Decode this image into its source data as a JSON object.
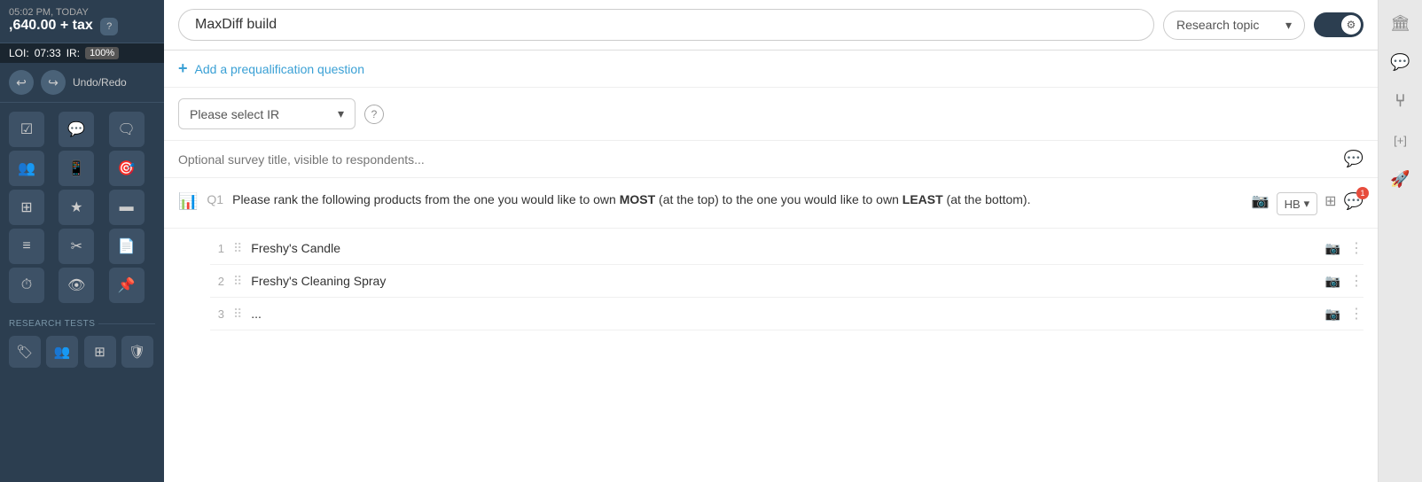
{
  "sidebar": {
    "timestamp": "05:02 PM, TODAY",
    "price": ",640.00 + tax",
    "help_icon": "?",
    "loi_label": "LOI:",
    "loi_value": "07:33",
    "ir_label": "IR:",
    "ir_value": "100%",
    "undo_redo_label": "Undo/Redo",
    "research_tests_label": "RESEARCH TESTS",
    "icons": [
      {
        "name": "checkbox-icon",
        "symbol": "☑"
      },
      {
        "name": "chat-bubble-icon",
        "symbol": "💬"
      },
      {
        "name": "speech-icon",
        "symbol": "🗨"
      },
      {
        "name": "audience-icon",
        "symbol": "👥"
      },
      {
        "name": "mobile-icon",
        "symbol": "📱"
      },
      {
        "name": "target-icon",
        "symbol": "🎯"
      },
      {
        "name": "table-icon",
        "symbol": "⊞"
      },
      {
        "name": "star-icon",
        "symbol": "★"
      },
      {
        "name": "slider-icon",
        "symbol": "▬"
      },
      {
        "name": "list-icon",
        "symbol": "≡"
      },
      {
        "name": "scissors-icon",
        "symbol": "✂"
      },
      {
        "name": "document-icon",
        "symbol": "📄"
      },
      {
        "name": "timer-icon",
        "symbol": "⏱"
      },
      {
        "name": "eye-off-icon",
        "symbol": "👁"
      },
      {
        "name": "pin-icon",
        "symbol": "📌"
      }
    ],
    "research_icons": [
      {
        "name": "tag-icon",
        "symbol": "🏷"
      },
      {
        "name": "users-icon",
        "symbol": "👥"
      },
      {
        "name": "grid-icon",
        "symbol": "⊞"
      },
      {
        "name": "shield-icon",
        "symbol": "🛡"
      }
    ]
  },
  "topbar": {
    "survey_title": "MaxDiff build",
    "survey_title_placeholder": "MaxDiff build",
    "research_topic_label": "Research topic",
    "gear_icon": "⚙"
  },
  "prequal": {
    "add_icon": "+",
    "add_text": "Add a prequalification question"
  },
  "ir_select": {
    "placeholder": "Please select IR",
    "help_icon": "?"
  },
  "optional_title": {
    "placeholder": "Optional survey title, visible to respondents..."
  },
  "question": {
    "number": "Q1",
    "text_part1": "Please rank the following products from the one you would like to own ",
    "text_bold1": "MOST",
    "text_part2": " (at the top) to the one you would like to own ",
    "text_bold2": "LEAST",
    "text_part3": " (at the bottom).",
    "hb_label": "HB",
    "comment_badge": "1"
  },
  "items": [
    {
      "number": "1",
      "text": "Freshy's Candle"
    },
    {
      "number": "2",
      "text": "Freshy's Cleaning Spray"
    },
    {
      "number": "3",
      "text": "..."
    }
  ],
  "right_panel": {
    "icons": [
      {
        "name": "building-icon",
        "symbol": "🏛"
      },
      {
        "name": "comment-panel-icon",
        "symbol": "💬"
      },
      {
        "name": "fork-icon",
        "symbol": "⑂"
      },
      {
        "name": "expand-icon",
        "symbol": "[+]"
      },
      {
        "name": "rocket-icon",
        "symbol": "🚀"
      }
    ]
  }
}
